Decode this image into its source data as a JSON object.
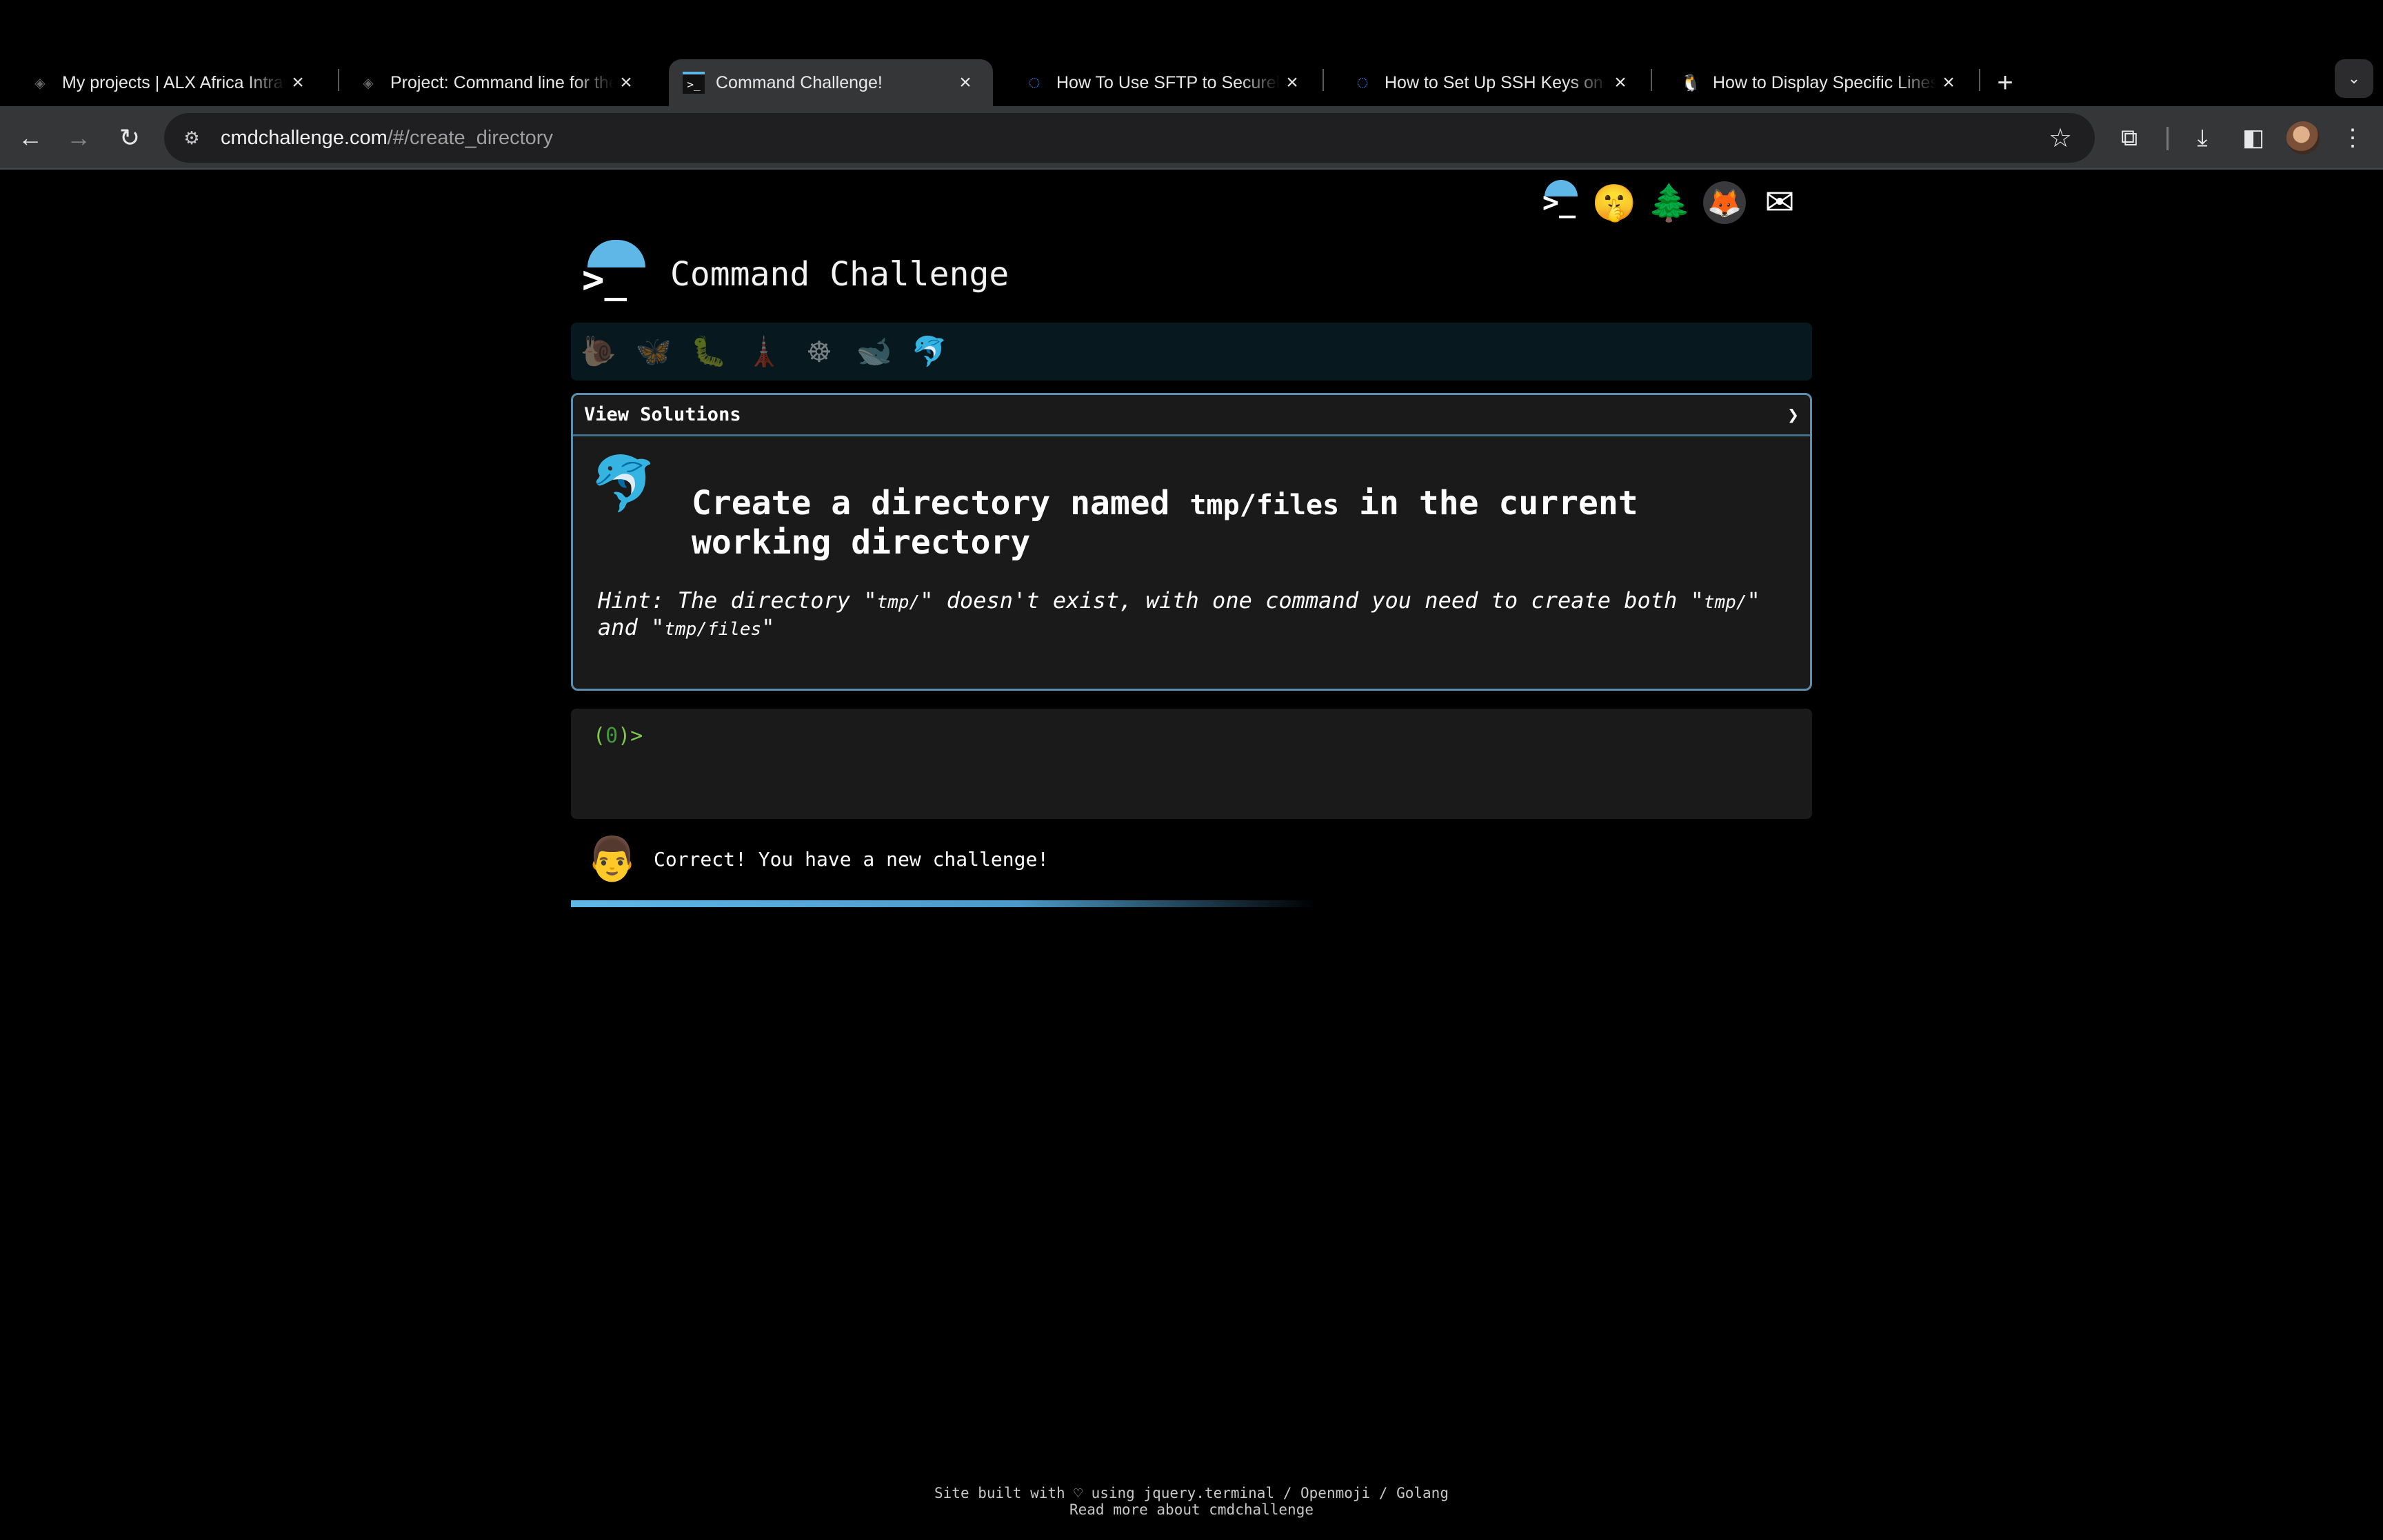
{
  "browser": {
    "tabs": [
      {
        "title": "My projects | ALX Africa Intranet",
        "favicon": "alx-favicon",
        "active": false
      },
      {
        "title": "Project: Command line for the web",
        "favicon": "alx-favicon",
        "active": false
      },
      {
        "title": "Command Challenge!",
        "favicon": "terminal-favicon",
        "active": true
      },
      {
        "title": "How To Use SFTP to Securely Transfer Files",
        "favicon": "digitalocean-favicon",
        "active": false
      },
      {
        "title": "How to Set Up SSH Keys on Ubuntu",
        "favicon": "digitalocean-favicon",
        "active": false
      },
      {
        "title": "How to Display Specific Lines of a File",
        "favicon": "linux-penguin-favicon",
        "active": false
      }
    ],
    "new_tab_glyph": "+",
    "url_host": "cmdchallenge.com",
    "url_path": "/#/create_directory"
  },
  "page": {
    "site_title": "Command Challenge",
    "top_icons": [
      "terminal-icon",
      "shushing-face-icon",
      "tree-icon",
      "gitlab-icon",
      "envelope-icon"
    ],
    "levels": [
      {
        "name": "snail",
        "glyph": "🐌",
        "completed": false
      },
      {
        "name": "butterfly",
        "glyph": "🦋",
        "completed": false
      },
      {
        "name": "caterpillar",
        "glyph": "🐛",
        "completed": false
      },
      {
        "name": "lighthouse",
        "glyph": "🗼",
        "completed": false
      },
      {
        "name": "wheel",
        "glyph": "☸",
        "completed": false
      },
      {
        "name": "whale",
        "glyph": "🐋",
        "completed": false
      },
      {
        "name": "dolphin",
        "glyph": "🐬",
        "completed": true
      }
    ],
    "view_solutions": "View Solutions",
    "chevron": "❯",
    "challenge": {
      "icon": "dolphin-icon",
      "title_before": "Create a directory named ",
      "title_code": "tmp/files",
      "title_after": " in the current working directory",
      "hint_1": "Hint: The directory \"",
      "hint_code_1": "tmp/",
      "hint_2": "\" doesn't exist, with one command you need to create both \"",
      "hint_code_2": "tmp/",
      "hint_3": "\" and \"",
      "hint_code_3": "tmp/files",
      "hint_4": "\""
    },
    "terminal": {
      "prompt_open": "(",
      "count": "0",
      "prompt_close": ")>"
    },
    "feedback": {
      "message": "Correct! You have a new challenge!",
      "progress": 0.6
    },
    "footer": {
      "line1": "Site built with ♡ using jquery.terminal / Openmoji / Golang",
      "line2": "Read more about cmdchallenge"
    }
  }
}
